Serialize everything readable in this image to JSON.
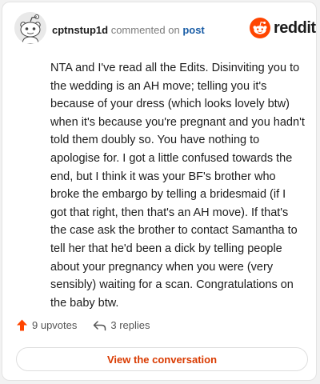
{
  "header": {
    "username": "cptnstup1d",
    "action_text": "commented on",
    "post_link": "post"
  },
  "logo": {
    "text": "reddit",
    "icon": "reddit-alien-icon",
    "color": "#ff4500"
  },
  "comment": {
    "body": "NTA and I've read all the Edits. Disinviting you to the wedding is an AH move; telling you it's because of your dress (which looks lovely btw) when it's because you're pregnant and you hadn't told them doubly so. You have nothing to apologise for. I got a little confused towards the end, but I think it was your BF's brother who broke the embargo by telling a bridesmaid (if I got that right, then that's an AH move). If that's the case ask the brother to contact Samantha to tell her that he'd been a dick by telling people about your pregnancy when you were (very sensibly) waiting for a scan. Congratulations on the baby btw."
  },
  "footer": {
    "upvotes": "9 upvotes",
    "upvote_icon": "upvote-arrow-icon",
    "replies": "3 replies",
    "reply_icon": "reply-arrow-icon"
  },
  "cta": {
    "label": "View the conversation",
    "color": "#d93a00"
  }
}
